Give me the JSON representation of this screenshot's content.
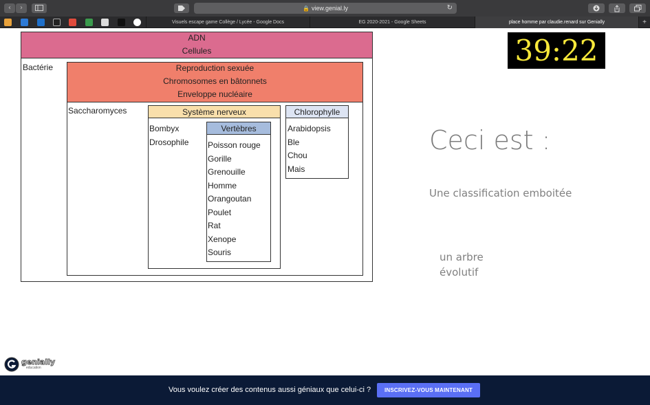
{
  "browser": {
    "url": "view.genial.ly",
    "tabs": [
      "Visuels escape game Collège / Lycée - Google Docs",
      "EG 2020-2021 - Google Sheets",
      "place homme par claudie.renard sur Genially"
    ],
    "new_tab_label": "+"
  },
  "diagram": {
    "outer_labels": [
      "ADN",
      "Cellules"
    ],
    "bacteria_label": "Bactérie",
    "eukaryote_labels": [
      "Reproduction sexuée",
      "Chromosomes en bâtonnets",
      "Enveloppe nucléaire"
    ],
    "saccharomyces_label": "Saccharomyces",
    "nervous_header": "Système nerveux",
    "nervous_items": [
      "Bombyx",
      "Drosophile"
    ],
    "vertebrate_header": "Vertèbres",
    "vertebrate_items": [
      "Poisson rouge",
      "Gorille",
      "Grenouille",
      "Homme",
      "Orangoutan",
      "Poulet",
      "Rat",
      "Xenope",
      "Souris"
    ],
    "chlorophyll_header": "Chlorophylle",
    "chlorophyll_items": [
      "Arabidopsis",
      "Ble",
      "Chou",
      "Mais"
    ],
    "colors": {
      "dna_band": "#db6b8f",
      "eukaryote_band": "#f07f6b",
      "nervous_header": "#f9dfab",
      "vertebrate_header": "#a6bcdd",
      "chlorophyll_header": "#dde4f3"
    }
  },
  "timer": {
    "value": "39:22",
    "color": "#f7e83a"
  },
  "question": {
    "heading": "Ceci est :"
  },
  "answers": [
    {
      "label": "Une classification emboitée"
    },
    {
      "label": "un arbre évolutif"
    }
  ],
  "logo": {
    "name": "genially",
    "subtitle": "education"
  },
  "banner": {
    "text": "Vous voulez créer des contenus aussi géniaux que celui-ci ?",
    "cta": "INSCRIVEZ-VOUS MAINTENANT",
    "cta_color": "#5a6ff5"
  }
}
